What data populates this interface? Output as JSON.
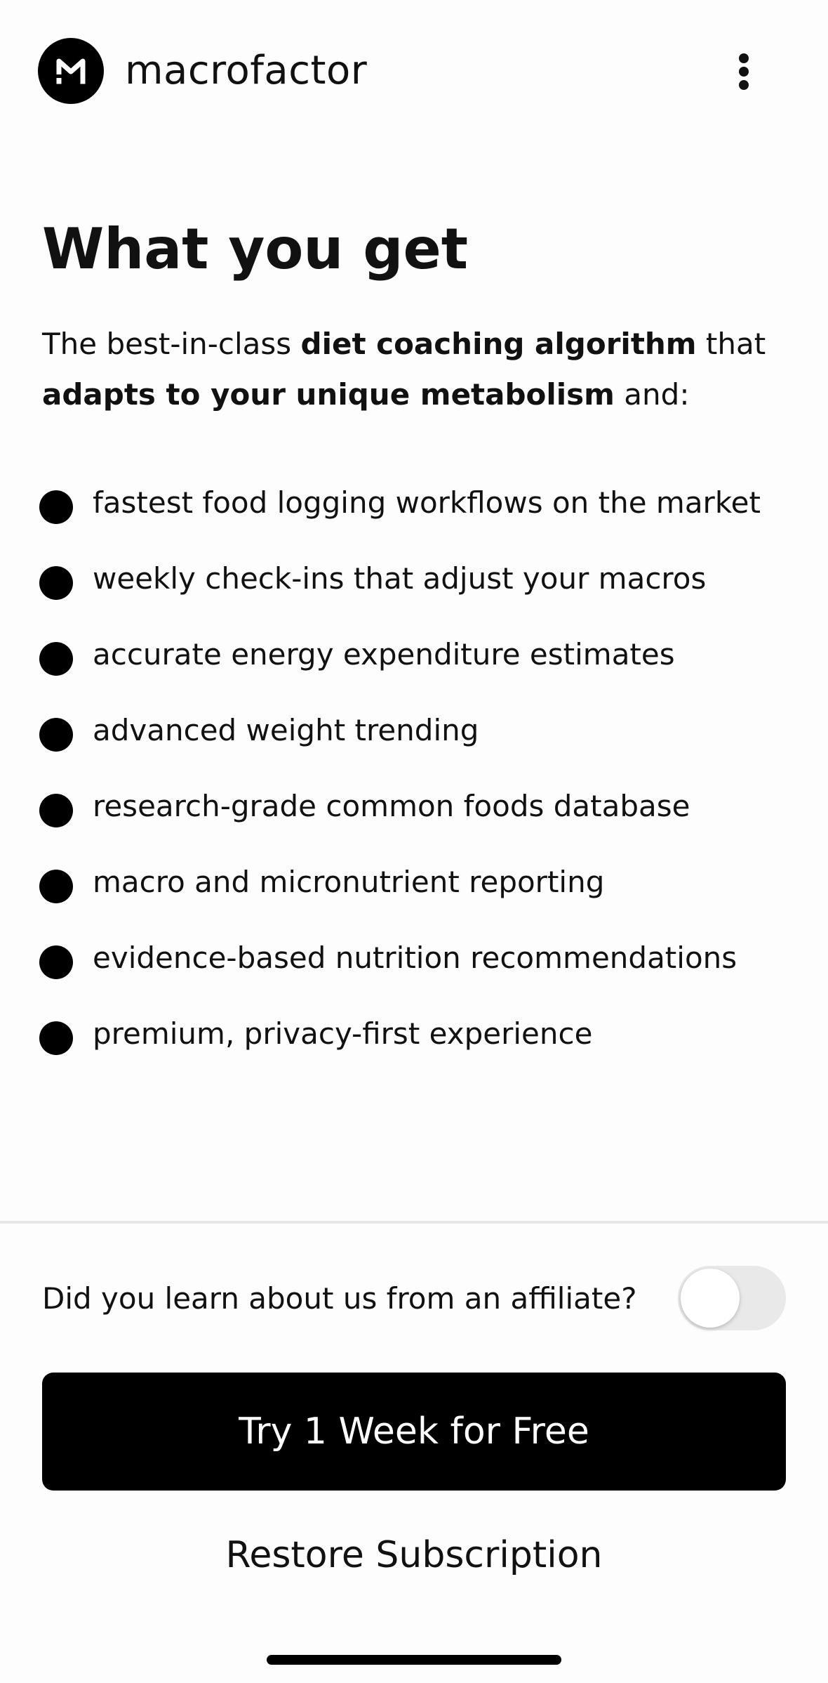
{
  "header": {
    "brand_name": "macrofactor",
    "logo_icon": "macrofactor-logo-icon",
    "menu_icon": "more-vertical-icon"
  },
  "main": {
    "title": "What you get",
    "intro": {
      "part1": "The best-in-class ",
      "bold1": "diet coaching algorithm",
      "part2": " that ",
      "bold2": "adapts to your unique metabolism",
      "part3": " and:"
    },
    "features": [
      "fastest food logging workflows on the market",
      "weekly check-ins that adjust your macros",
      "accurate energy expenditure estimates",
      "advanced weight trending",
      "research-grade common foods database",
      "macro and micronutrient reporting",
      "evidence-based nutrition recommendations",
      "premium, privacy-first experience"
    ]
  },
  "footer": {
    "affiliate_label": "Did you learn about us from an affiliate?",
    "affiliate_toggle_on": false,
    "cta_label": "Try 1 Week for Free",
    "restore_label": "Restore Subscription"
  },
  "colors": {
    "background": "#fdfdfd",
    "text": "#111111",
    "button": "#000000",
    "button_text": "#ffffff",
    "toggle_off": "#e9e9ea"
  }
}
